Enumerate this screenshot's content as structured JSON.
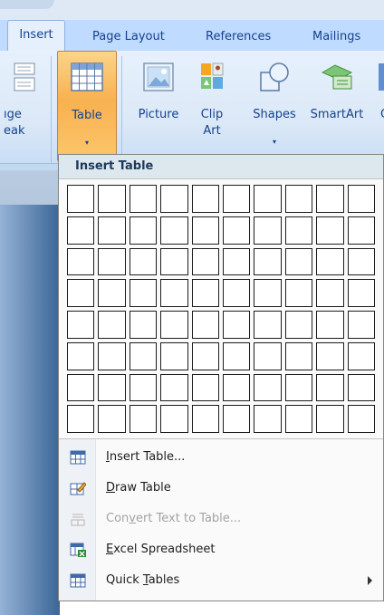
{
  "tabs": [
    {
      "label": "Insert",
      "active": true
    },
    {
      "label": "Page Layout"
    },
    {
      "label": "References"
    },
    {
      "label": "Mailings"
    }
  ],
  "ribbon": {
    "partial_button_label": "ıge\neak",
    "buttons": [
      {
        "label": "Table",
        "dropdown": "▾",
        "pressed": true,
        "icon": "table-icon"
      },
      {
        "label": "Picture",
        "icon": "picture-icon"
      },
      {
        "label": "Clip\nArt",
        "icon": "clip-art-icon"
      },
      {
        "label": "Shapes",
        "dropdown": "▾",
        "icon": "shapes-icon"
      },
      {
        "label": "SmartArt",
        "icon": "smartart-icon"
      },
      {
        "label": "C",
        "icon": "chart-icon"
      }
    ]
  },
  "insert_table": {
    "header": "Insert Table",
    "grid_columns": 10,
    "grid_rows": 8
  },
  "menu": {
    "items": [
      {
        "pre": "",
        "key": "I",
        "post": "nsert Table...",
        "icon": "insert-table-icon",
        "enabled": true
      },
      {
        "pre": "",
        "key": "D",
        "post": "raw Table",
        "icon": "draw-table-icon",
        "enabled": true
      },
      {
        "pre": "Con",
        "key": "v",
        "post": "ert Text to Table...",
        "icon": "convert-text-icon",
        "enabled": false
      },
      {
        "pre": "",
        "key": "E",
        "post": "xcel Spreadsheet",
        "icon": "excel-spreadsheet-icon",
        "enabled": true
      },
      {
        "pre": "Quick ",
        "key": "T",
        "post": "ables",
        "icon": "quick-tables-icon",
        "enabled": true,
        "submenu": true
      }
    ]
  },
  "colors": {
    "ribbon_text": "#15428b",
    "pressed_button": "#f8b150",
    "menu_header_bg": "#dde7ee",
    "disabled_text": "#a3a3a3"
  }
}
